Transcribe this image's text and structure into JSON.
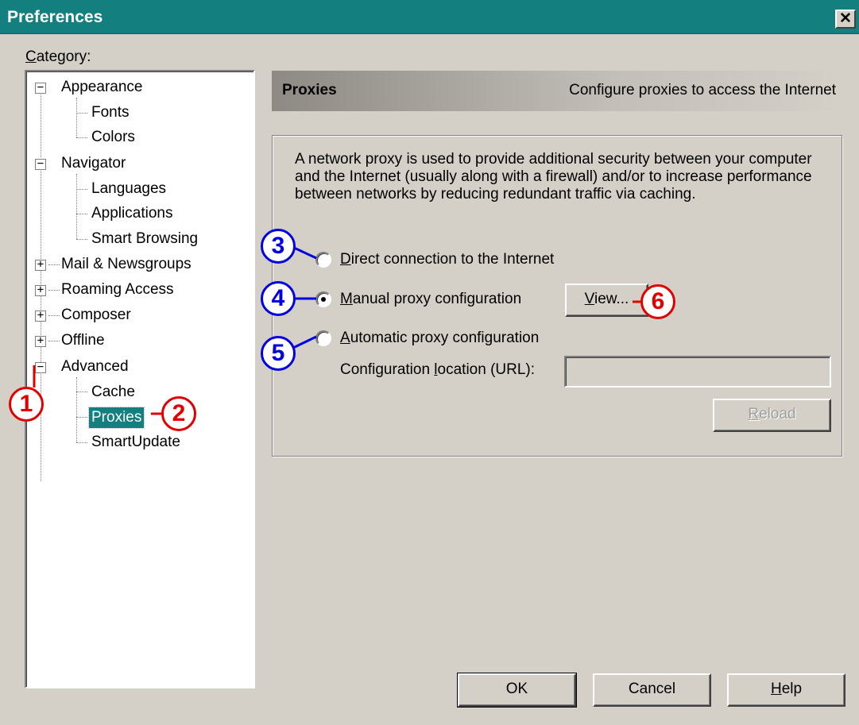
{
  "window": {
    "title": "Preferences",
    "close_label": "✕"
  },
  "category_label": "Category:",
  "tree": {
    "appearance": "Appearance",
    "fonts": "Fonts",
    "colors": "Colors",
    "navigator": "Navigator",
    "languages": "Languages",
    "applications": "Applications",
    "smart_browsing": "Smart Browsing",
    "mail_newsgroups": "Mail & Newsgroups",
    "roaming_access": "Roaming Access",
    "composer": "Composer",
    "offline": "Offline",
    "advanced": "Advanced",
    "cache": "Cache",
    "proxies": "Proxies",
    "smartupdate": "SmartUpdate",
    "collapse_symbol": "−",
    "expand_symbol": "+"
  },
  "panel": {
    "title": "Proxies",
    "description": "Configure proxies to access the Internet",
    "intro": "A network proxy is used to provide additional security between your computer and the Internet (usually along with a firewall) and/or to increase performance between networks by reducing redundant traffic via caching.",
    "direct_label": "Direct connection to the Internet",
    "manual_label": "Manual proxy configuration",
    "automatic_label": "Automatic proxy configuration",
    "view_label": "View...",
    "config_location_label": "Configuration location (URL):",
    "config_location_value": "",
    "reload_label": "Reload",
    "selected_option": "manual"
  },
  "buttons": {
    "ok": "OK",
    "cancel": "Cancel",
    "help": "Help"
  },
  "callouts": [
    "1",
    "2",
    "3",
    "4",
    "5",
    "6"
  ],
  "colors": {
    "titlebar": "#137f7e",
    "callout_red": "#e00000",
    "callout_blue": "#0000e0"
  }
}
